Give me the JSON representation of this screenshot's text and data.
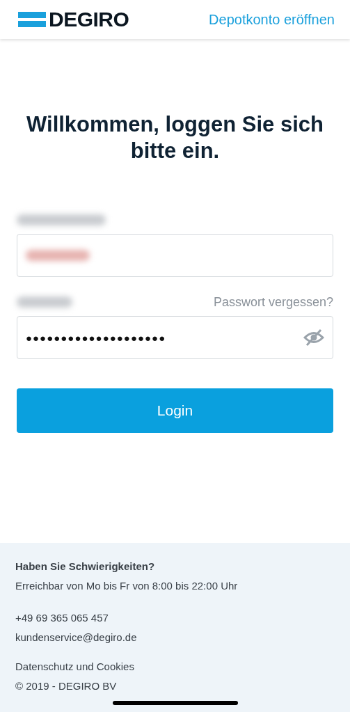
{
  "header": {
    "brand": "DEGIRO",
    "link": "Depotkonto eröffnen"
  },
  "login": {
    "heading": "Willkommen, loggen Sie sich bitte ein.",
    "forgot_link": "Passwort vergessen?",
    "password_value": "●●●●●●●●●●●●●●●●●●●●",
    "button": "Login"
  },
  "footer": {
    "title": "Haben Sie Schwierigkeiten?",
    "hours": "Erreichbar von Mo bis Fr von 8:00 bis 22:00 Uhr",
    "phone": "+49 69 365 065 457",
    "email": "kundenservice@degiro.de",
    "privacy": "Datenschutz und Cookies",
    "copyright": "© 2019 - DEGIRO BV"
  }
}
